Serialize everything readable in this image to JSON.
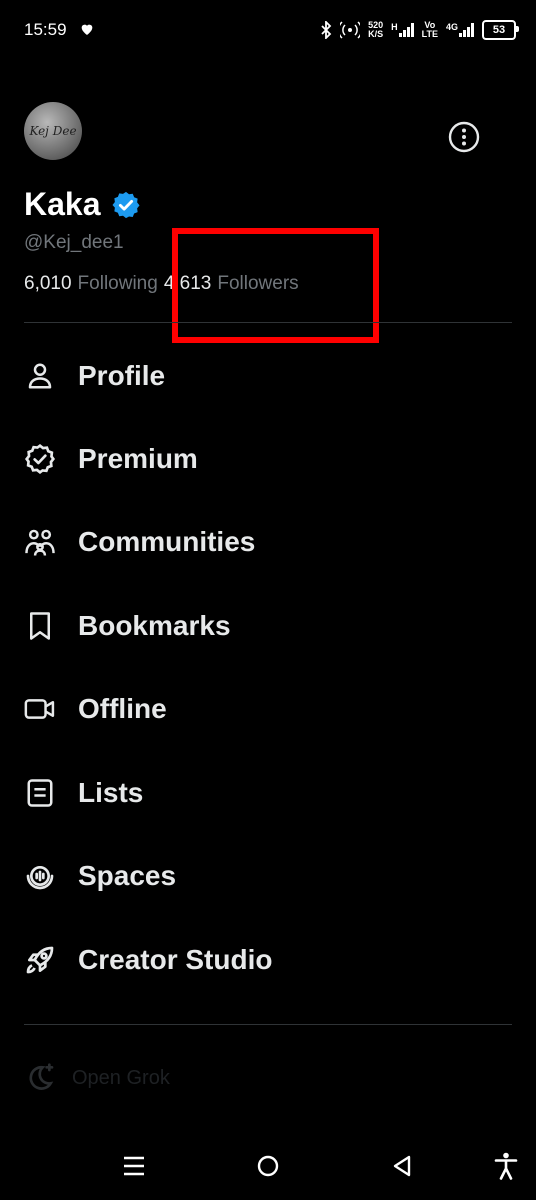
{
  "status_bar": {
    "time": "15:59",
    "net_speed_top": "520",
    "net_speed_bottom": "K/S",
    "net_h": "H",
    "volte_top": "Vo",
    "volte_bottom": "LTE",
    "lte": "4G",
    "battery": "53"
  },
  "profile": {
    "avatar_logo": "Kej Dee",
    "display_name": "Kaka",
    "handle": "@Kej_dee1",
    "following_count": "6,010",
    "following_label": "Following",
    "followers_count": "4,613",
    "followers_label": "Followers",
    "verified_color": "#1d9bf0"
  },
  "menu": {
    "items": [
      {
        "label": "Profile",
        "icon": "person-icon"
      },
      {
        "label": "Premium",
        "icon": "premium-badge-icon"
      },
      {
        "label": "Communities",
        "icon": "communities-icon"
      },
      {
        "label": "Bookmarks",
        "icon": "bookmark-icon"
      },
      {
        "label": "Offline",
        "icon": "video-icon"
      },
      {
        "label": "Lists",
        "icon": "lists-icon"
      },
      {
        "label": "Spaces",
        "icon": "spaces-icon"
      },
      {
        "label": "Creator Studio",
        "icon": "rocket-icon"
      }
    ],
    "grok_label": "Open Grok"
  },
  "colors": {
    "background": "#000000",
    "highlight": "#ff0000",
    "muted_text": "#71767b"
  }
}
